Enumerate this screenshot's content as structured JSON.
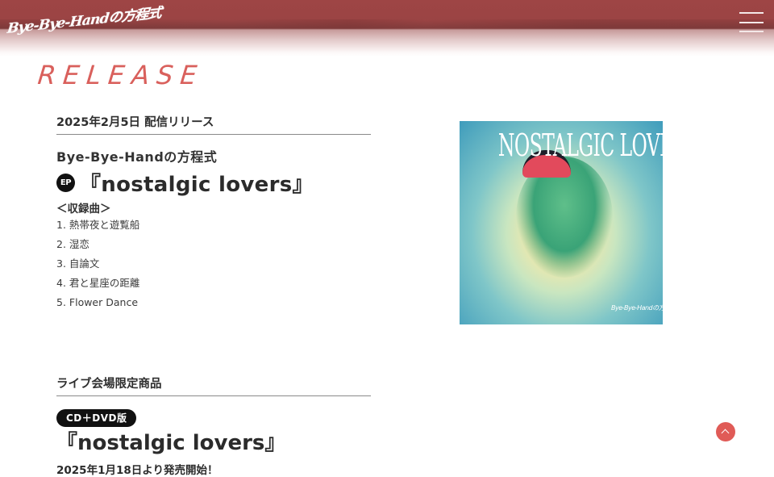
{
  "header": {
    "logo_text": "Bye-Bye-Handの方程式",
    "menu_icon": "hamburger-menu-icon"
  },
  "section": {
    "title": "RELEASE"
  },
  "release": {
    "date_heading": "2025年2月5日 配信リリース",
    "artist": "Bye-Bye-Handの方程式",
    "format_badge": "EP",
    "album_title": "『nostalgic lovers』",
    "tracks_label": "＜収録曲＞",
    "tracks": [
      "1. 熱帯夜と遊覧船",
      "2. 湿恋",
      "3. 自論文",
      "4. 君と星座の距離",
      "5. Flower Dance"
    ],
    "cover": {
      "title": "NOSTALGIC LOVERS",
      "logo": "Bye-Bye-Handの方程式"
    }
  },
  "limited": {
    "heading": "ライブ会場限定商品",
    "format_badge": "CD＋DVD版",
    "album_title": "『nostalgic lovers』",
    "release_note": "2025年1月18日より発売開始！"
  },
  "controls": {
    "back_to_top_icon": "chevron-up-icon"
  },
  "colors": {
    "header_bg": "#9e4545",
    "accent": "#d9605c",
    "back_to_top": "#e05b57",
    "badge_bg": "#111111"
  }
}
